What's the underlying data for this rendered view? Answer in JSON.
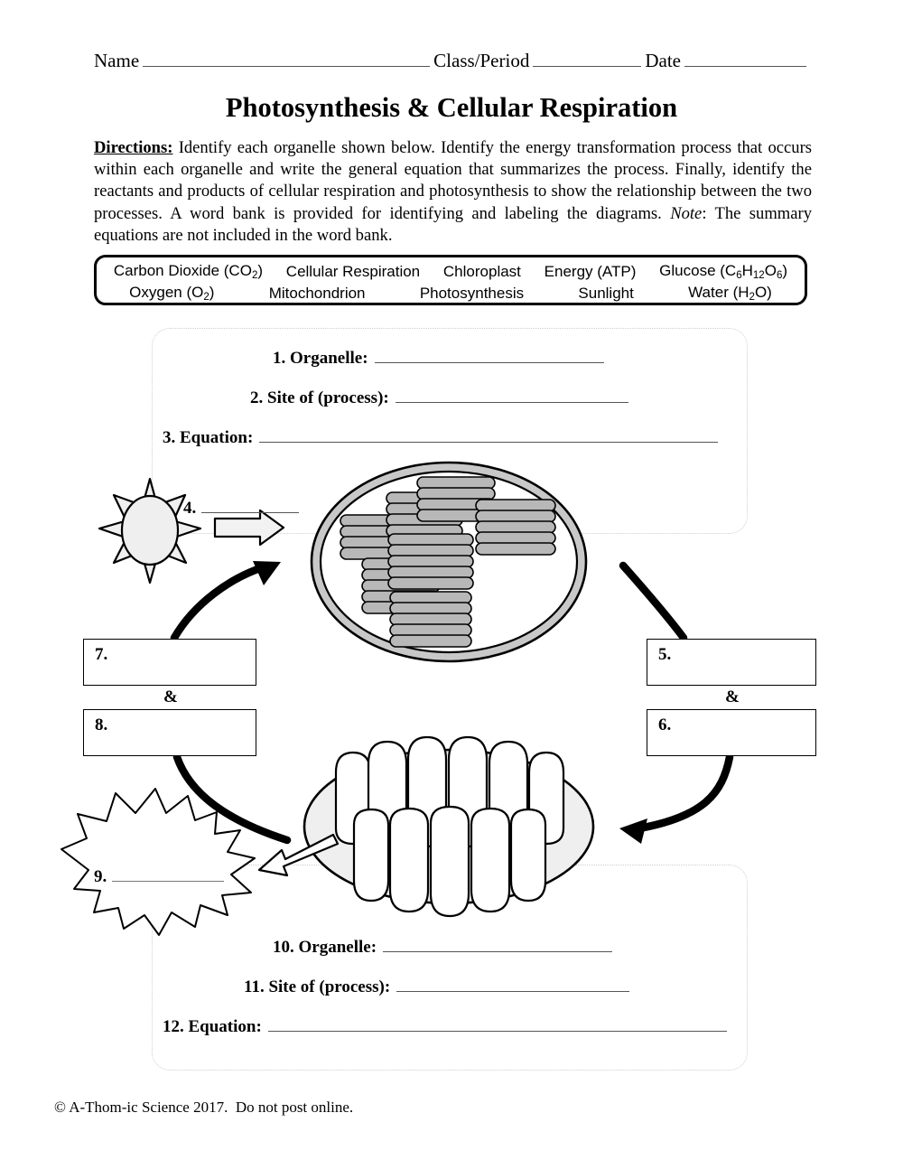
{
  "header": {
    "name_label": "Name",
    "class_label": "Class/Period",
    "date_label": "Date"
  },
  "title": "Photosynthesis & Cellular Respiration",
  "directions": {
    "label": "Directions:",
    "text_part1": " Identify each organelle shown below. Identify the energy transformation process that occurs within each organelle and write the general equation that summarizes the process. Finally, identify the reactants and products of cellular respiration and photosynthesis to show the relationship between the two processes. A word bank is provided for identifying and labeling the diagrams. ",
    "note_label": "Note",
    "text_part2": ": The summary equations are not included in the word bank."
  },
  "word_bank": {
    "row1": [
      "Carbon Dioxide (CO₂)",
      "Cellular Respiration",
      "Chloroplast",
      "Energy (ATP)",
      "Glucose (C₆H₁₂O₆)"
    ],
    "row2": [
      "Oxygen (O₂)",
      "Mitochondrion",
      "Photosynthesis",
      "Sunlight",
      "Water (H₂O)"
    ]
  },
  "questions": {
    "q1": "1. Organelle:",
    "q2": "2.  Site of (process):",
    "q3": "3.  Equation:",
    "q4": "4.",
    "q9": "9.",
    "q10": "10. Organelle:",
    "q11": "11.  Site of (process):",
    "q12": "12.  Equation:"
  },
  "boxes": {
    "box5": "5.",
    "box6": "6.",
    "box7": "7.",
    "box8": "8.",
    "amp_left": "&",
    "amp_right": "&"
  },
  "diagram": {
    "sun_name": "sun",
    "chloroplast_name": "chloroplast",
    "mitochondrion_name": "mitochondrion",
    "starburst_name": "energy-burst"
  },
  "colors": {
    "ink": "#000000",
    "rule": "#555555",
    "organelle_fill": "#efefef",
    "granum_fill": "#b8b8b8",
    "membrane_fill": "#c8c8c8",
    "panel_border": "#cfcfcf"
  },
  "footer": "© A-Thom-ic Science 2017.  Do not post online."
}
